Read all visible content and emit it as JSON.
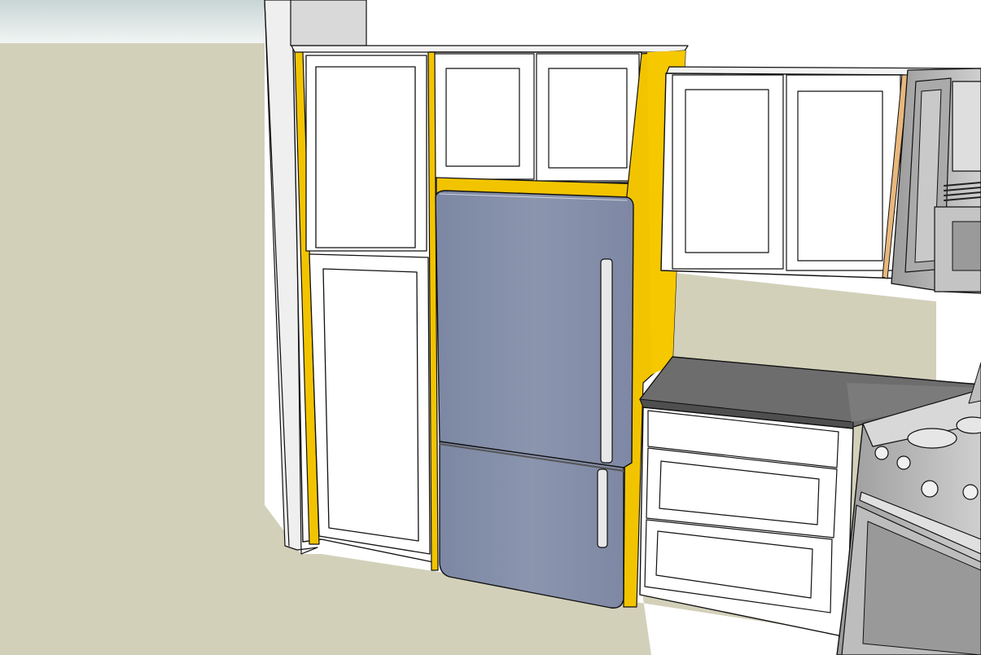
{
  "scene": {
    "kind": "3d-model-viewport",
    "objects": [
      "sky",
      "ground-plane",
      "back-wall",
      "tall-pantry-cabinet",
      "upper-cabinet-above-refrigerator",
      "yellow-filler-panels",
      "refrigerator",
      "upper-wall-cabinet",
      "range-hood-microwave",
      "countertop",
      "base-drawer-cabinet",
      "electric-range"
    ],
    "colors": {
      "sky": "#e8eeee",
      "ground": "#d3d0ba",
      "wall": "#ffffff",
      "filler": "#f2c400",
      "fridge": "#8791ab",
      "countertop": "#6d6d6d",
      "steel": "#b5b5b5",
      "outline": "#111111"
    }
  }
}
